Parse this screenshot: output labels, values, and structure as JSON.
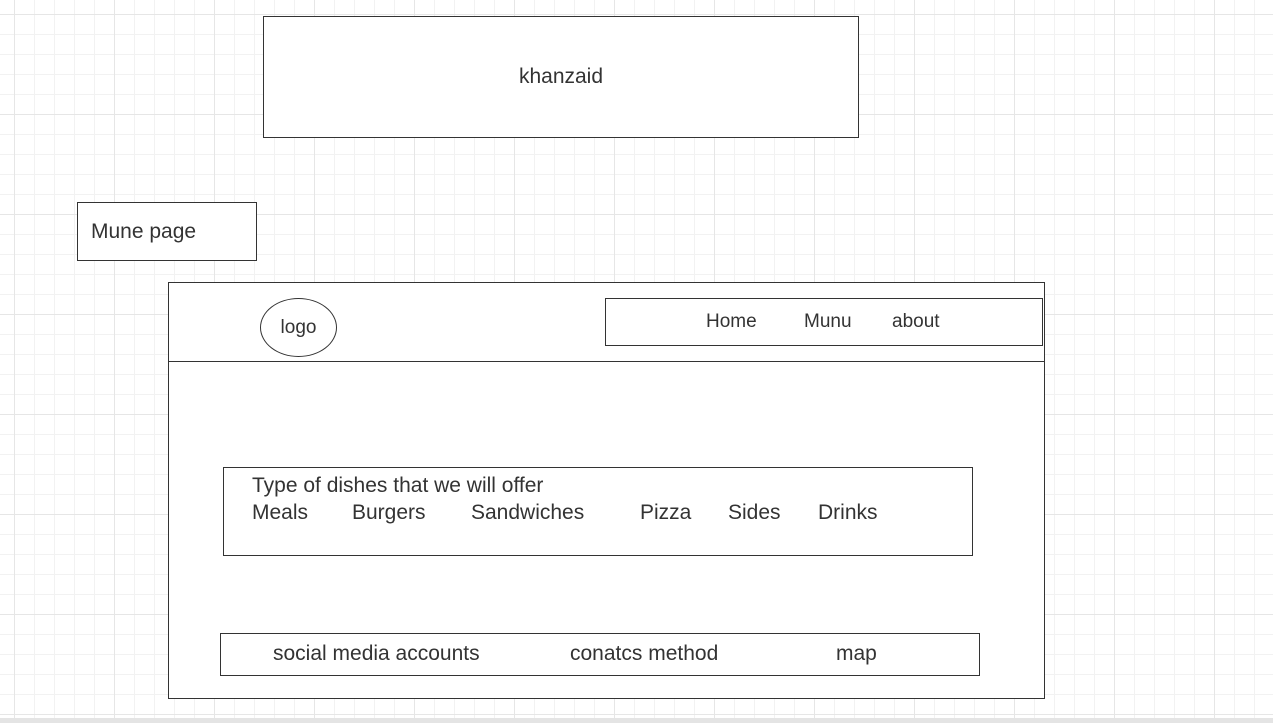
{
  "title_box": {
    "text": "khanzaid"
  },
  "page_label": {
    "text": "Mune page"
  },
  "wireframe": {
    "logo": "logo",
    "nav": [
      "Home",
      "Munu",
      "about"
    ],
    "dishes": {
      "heading": "Type of dishes that we will offer",
      "items": [
        "Meals",
        "Burgers",
        "Sandwiches",
        "Pizza",
        "Sides",
        "Drinks"
      ]
    },
    "footer": [
      "social media accounts",
      "conatcs method",
      "map"
    ]
  }
}
